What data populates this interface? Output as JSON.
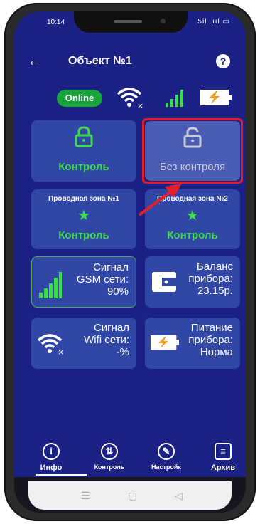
{
  "status_bar": {
    "time": "10:14",
    "icons": "5il .ııl ▭"
  },
  "header": {
    "back": "←",
    "title": "Объект №1",
    "help": "?"
  },
  "status_row": {
    "online_label": "Online"
  },
  "security": {
    "control": {
      "label": "Контроль"
    },
    "no_control": {
      "label": "Без контроля"
    }
  },
  "zones": [
    {
      "title": "Проводная зона №1",
      "status": "Контроль"
    },
    {
      "title": "Проводная зона №2",
      "status": "Контроль"
    }
  ],
  "info": {
    "gsm": {
      "lines": [
        "Сигнал",
        "GSM сети:",
        "90%"
      ]
    },
    "balance": {
      "lines": [
        "Баланс",
        "прибора:",
        "23.15р."
      ]
    },
    "wifi": {
      "lines": [
        "Сигнал",
        "Wifi сети:",
        "-%"
      ]
    },
    "power": {
      "lines": [
        "Питание",
        "прибора:",
        "Норма"
      ]
    }
  },
  "nav": {
    "info": "Инфо",
    "control": "Контроль",
    "settings": "Настройк",
    "archive": "Архив"
  },
  "colors": {
    "background": "#1c2185",
    "card": "#3147a6",
    "accent_green": "#3ddc4a",
    "highlight": "#e1202b"
  }
}
